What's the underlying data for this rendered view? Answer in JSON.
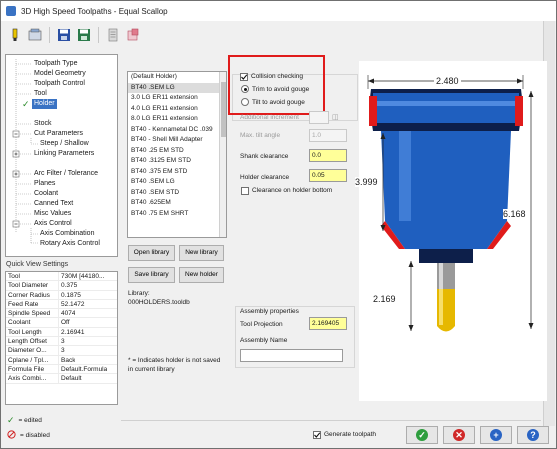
{
  "window": {
    "title": "3D High Speed Toolpaths - Equal Scallop"
  },
  "toolbar": {
    "icons": [
      "highlighter-icon",
      "view-icon",
      "save-icon",
      "save-as-icon",
      "notes-icon",
      "reset-icon"
    ]
  },
  "tree": {
    "items": [
      {
        "label": "Toolpath Type"
      },
      {
        "label": "Model Geometry"
      },
      {
        "label": "Toolpath Control"
      },
      {
        "label": "Tool"
      },
      {
        "label": "Holder"
      },
      {
        "label": "Stock"
      },
      {
        "label": "Cut Parameters"
      },
      {
        "label": "Steep / Shallow"
      },
      {
        "label": "Linking Parameters"
      },
      {
        "label": "Arc Filter / Tolerance"
      },
      {
        "label": "Planes"
      },
      {
        "label": "Coolant"
      },
      {
        "label": "Canned Text"
      },
      {
        "label": "Misc Values"
      },
      {
        "label": "Axis Control"
      },
      {
        "label": "Axis Combination"
      },
      {
        "label": "Rotary Axis Control"
      }
    ]
  },
  "quick_view": {
    "title": "Quick View Settings",
    "rows": [
      {
        "k": "Tool",
        "v": "730M  [44180..."
      },
      {
        "k": "Tool Diameter",
        "v": "0.375"
      },
      {
        "k": "Corner Radius",
        "v": "0.1875"
      },
      {
        "k": "Feed Rate",
        "v": "52.1472"
      },
      {
        "k": "Spindle Speed",
        "v": "4074"
      },
      {
        "k": "Coolant",
        "v": "Off"
      },
      {
        "k": "Tool Length",
        "v": "2.16941"
      },
      {
        "k": "Length Offset",
        "v": "3"
      },
      {
        "k": "Diameter O...",
        "v": "3"
      },
      {
        "k": "Cplane / Tpl...",
        "v": "Back"
      },
      {
        "k": "Formula File",
        "v": "Default.Formula"
      },
      {
        "k": "Axis Combi...",
        "v": "Default"
      }
    ]
  },
  "legend": {
    "edited": "= edited",
    "disabled": "= disabled"
  },
  "holder_list": {
    "items": [
      "(Default Holder)",
      "BT40 .SEM LG",
      "3.0 LG ER11 extension",
      "4.0 LG ER11 extension",
      "8.0 LG ER11 extension",
      "BT40 - Kennametal DC .039",
      "BT40 - Shell Mill Adapter",
      "BT40 .25 EM STD",
      "BT40 .3125 EM STD",
      "BT40 .375 EM STD",
      "BT40 .SEM LG",
      "BT40 .SEM STD",
      "BT40 .625EM",
      "BT40 .75 EM SHRT"
    ],
    "selected_index": 1
  },
  "buttons": {
    "open_library": "Open library",
    "new_library": "New library",
    "save_library": "Save library",
    "new_holder": "New holder"
  },
  "library": {
    "label": "Library:",
    "file": "000HOLDERS.tooldb"
  },
  "note": {
    "line1": "* = Indicates holder is not saved",
    "line2": "in current library"
  },
  "collision": {
    "collision_checking": "Collision checking",
    "trim_label": "Trim to avoid gouge",
    "tilt_label": "Tilt to avoid gouge",
    "trim_selected": true,
    "additional_increment": "Additional increment",
    "max_tilt_label": "Max. tilt angle",
    "max_tilt_value": "1.0",
    "shank_label": "Shank clearance",
    "shank_value": "0.0",
    "holder_label": "Holder clearance",
    "holder_value": "0.05",
    "clearance_bottom": "Clearance on holder bottom"
  },
  "assembly": {
    "title": "Assembly properties",
    "tool_projection_label": "Tool Projection",
    "tool_projection_value": "2.169405",
    "assembly_name_label": "Assembly Name",
    "assembly_name_value": ""
  },
  "preview": {
    "dim_top": "2.480",
    "dim_left": "3.999",
    "dim_right": "6.168",
    "dim_bottom": "2.169"
  },
  "footer": {
    "generate_toolpath": "Generate toolpath",
    "generate_checked": true
  },
  "colors": {
    "accent": "#3a73c4",
    "highlight_red": "#e01b1b",
    "field_yellow": "#ffff99",
    "holder_blue": "#1f5fbf",
    "tool_gold": "#e6b800"
  }
}
